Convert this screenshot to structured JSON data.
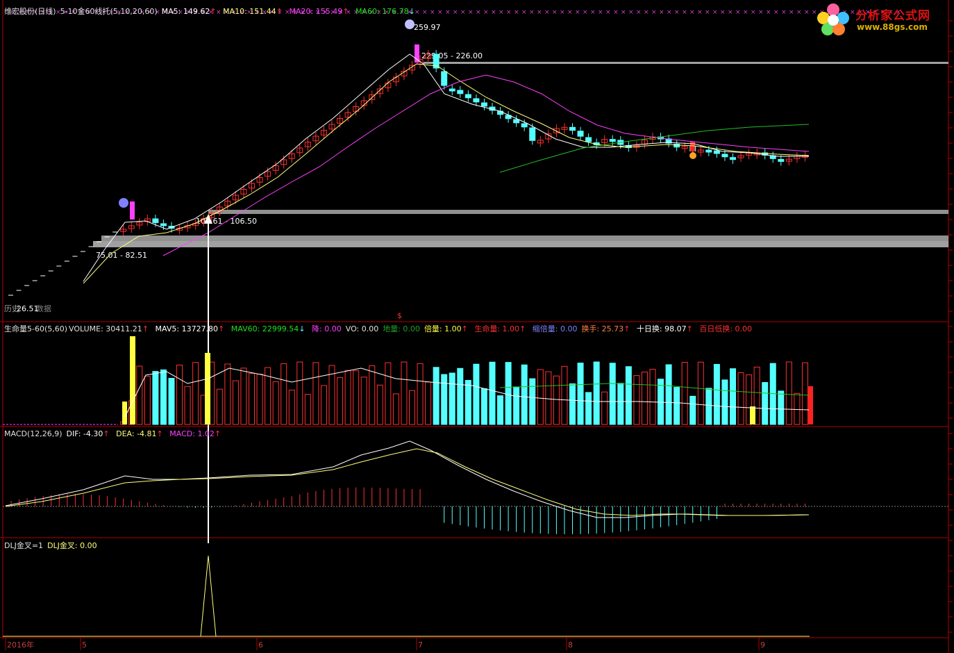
{
  "header": {
    "title": "维宏股份(日线)",
    "indicator": "5-10金60线托(5,10,20,60)",
    "ma5_label": "MA5: 149.62",
    "ma10_label": "MA10: 151.44",
    "ma20_label": "MA20: 155.49",
    "ma60_label": "MA60: 176.78"
  },
  "price_labels": {
    "peak": "259.97",
    "upper_zone": "229.05 - 226.00",
    "mid_zone": "103.61 - 106.50",
    "low_zone": "75.01 - 82.51",
    "bottom": "26.51",
    "bottom_note": "数据",
    "bottom_prefix": "历史"
  },
  "volume_header": {
    "name": "生命量5-60(5,60)",
    "volume": "VOLUME: 30411.21",
    "mav5": "MAV5: 13727.80",
    "mav60": "MAV60: 22999.54",
    "jiang": "降: 0.00",
    "vo": "VO: 0.00",
    "diliang": "地量: 0.00",
    "beiliang": "倍量: 1.00",
    "shengming": "生命量: 1.00",
    "suobei": "缩倍量: 0.00",
    "huanshou": "换手: 25.73",
    "shirihuan": "十日换: 98.07",
    "bairi": "百日低换: 0.00"
  },
  "macd_header": {
    "name": "MACD(12,26,9)",
    "dif": "DIF: -4.30",
    "dea": "DEA: -4.81",
    "macd": "MACD: 1.02"
  },
  "dlj_header": {
    "name": "DLJ金叉=1",
    "value": "DLJ金叉: 0.00"
  },
  "time_axis": [
    "2016年",
    "5",
    "6",
    "7",
    "8",
    "9"
  ],
  "logo": {
    "name": "分析家公式网",
    "url": "www.88gs.com"
  },
  "colors": {
    "up": "#ff3030",
    "down": "#54ffff",
    "ma5": "#ffffff",
    "ma10": "#ffff80",
    "ma20": "#ff40ff",
    "ma60": "#20c020",
    "axis": "#b00000"
  }
}
